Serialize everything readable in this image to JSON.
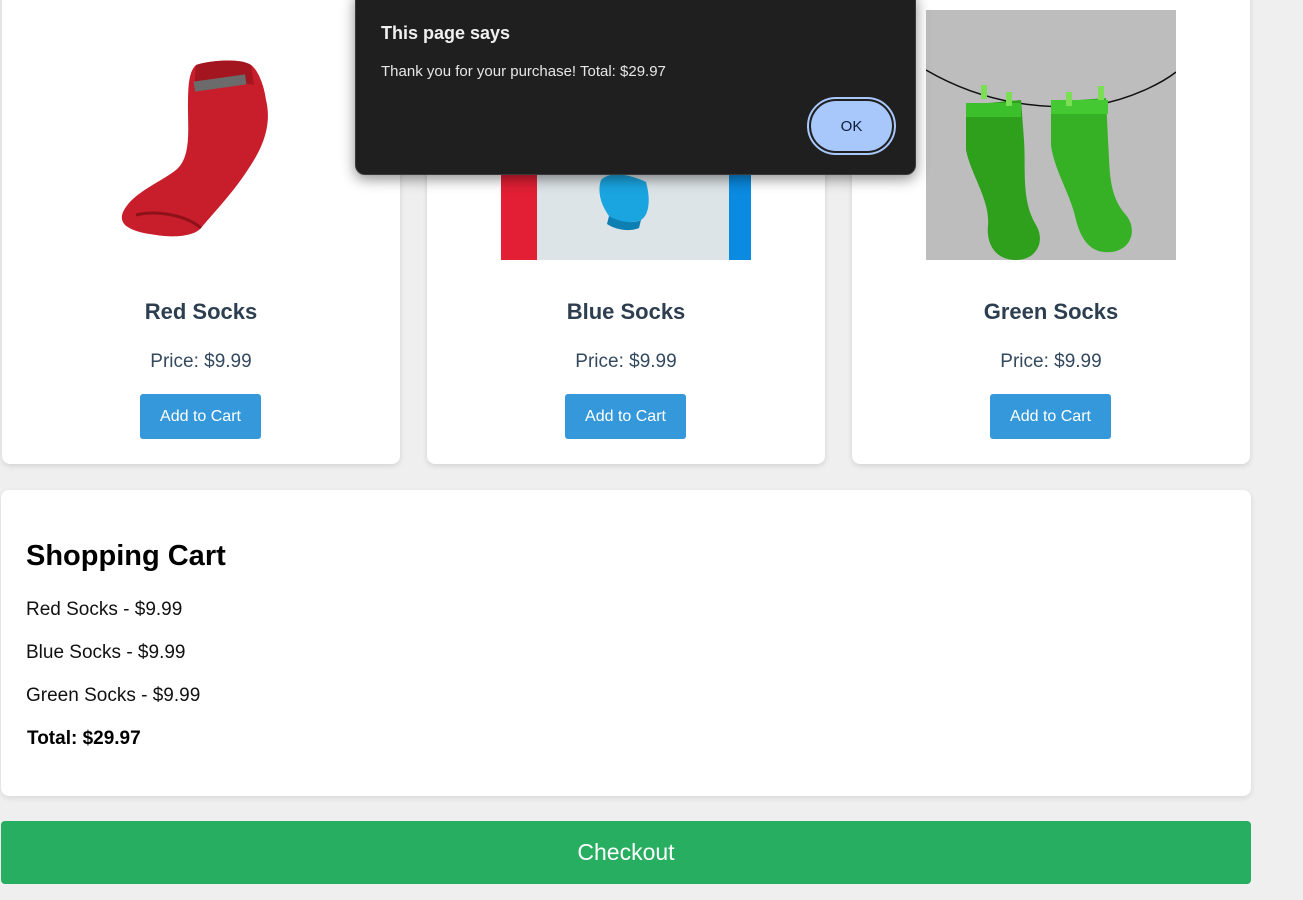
{
  "products": [
    {
      "name": "Red Socks",
      "price": "Price: $9.99",
      "button": "Add to Cart",
      "image": "red-sock-photo"
    },
    {
      "name": "Blue Socks",
      "price": "Price: $9.99",
      "button": "Add to Cart",
      "image": "blue-sock-photo"
    },
    {
      "name": "Green Socks",
      "price": "Price: $9.99",
      "button": "Add to Cart",
      "image": "green-socks-photo"
    }
  ],
  "cart": {
    "title": "Shopping Cart",
    "items": [
      "Red Socks - $9.99",
      "Blue Socks - $9.99",
      "Green Socks - $9.99"
    ],
    "total": "Total: $29.97"
  },
  "checkout": {
    "label": "Checkout"
  },
  "dialog": {
    "title": "This page says",
    "message": "Thank you for your purchase! Total: $29.97",
    "ok_label": "OK"
  },
  "colors": {
    "add_button": "#3498db",
    "checkout_button": "#27ae60",
    "dialog_bg": "#1f1f1f",
    "ok_button": "#a8c7fa"
  }
}
